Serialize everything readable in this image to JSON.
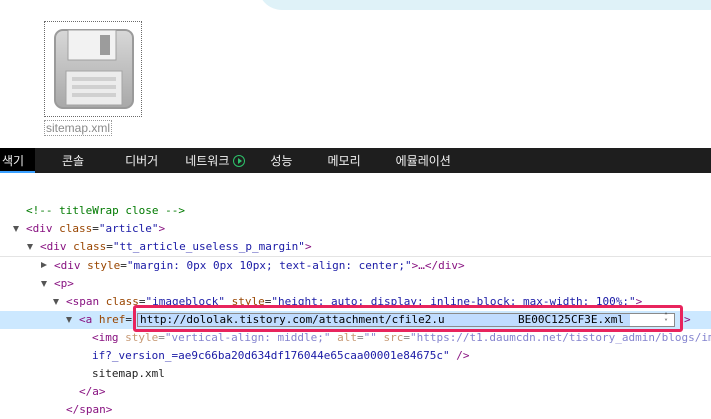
{
  "file_icon": {
    "label": "sitemap.xml",
    "icon": "floppy-disk-icon"
  },
  "tabs": [
    {
      "label": "색기",
      "active": true
    },
    {
      "label": "콘솔",
      "active": false
    },
    {
      "label": "디버거",
      "active": false
    },
    {
      "label": "네트워크",
      "active": false,
      "icon": "play-circle-icon"
    },
    {
      "label": "성능",
      "active": false
    },
    {
      "label": "메모리",
      "active": false
    },
    {
      "label": "에뮬레이션",
      "active": false
    }
  ],
  "dom_tree": {
    "line1": {
      "comment": "<!-- titleWrap close -->"
    },
    "line2": {
      "open": "<div ",
      "attr": "class",
      "eq": "=",
      "val": "\"article\"",
      "close": ">"
    },
    "line3": {
      "open": "<div ",
      "attr": "class",
      "eq": "=",
      "val": "\"tt_article_useless_p_margin\"",
      "close": ">"
    },
    "line4": {
      "open": "<div ",
      "attr": "style",
      "eq": "=",
      "val": "\"margin: 0px 0px 10px; text-align: center;\"",
      "close": ">…</div>"
    },
    "line5": {
      "tag": "<p>"
    },
    "line6": {
      "open": "<span ",
      "attr1": "class",
      "eq1": "=",
      "val1": "\"imageblock\"",
      "attr2": " style",
      "eq2": "=",
      "val2": "\"height: auto; display: inline-block; max-width: 100%;\"",
      "close": ">"
    },
    "line7": {
      "open": "<a ",
      "attr": "href",
      "eq": "=",
      "end": ">"
    },
    "line8": {
      "open": "<img ",
      "attr1": "style",
      "eq1": "=",
      "val1": "\"vertical-align: middle;\"",
      "attr2": " alt",
      "eq2": "=",
      "val2": "\"\"",
      "attr3": " src",
      "eq3": "=",
      "val3": "\"https://t1.daumcdn.net/tistory_admin/blogs/im"
    },
    "line9": {
      "val": "if?_version_=ae9c66ba20d634df176044e65caa00001e84675c\"",
      "close": " />"
    },
    "line10": {
      "text": "sitemap.xml"
    },
    "line11": {
      "tag": "</a>"
    },
    "line12": {
      "tag": "</span>"
    }
  },
  "url_editor": {
    "value_start": "http://dololak.tistory.com/attachment/cfile2.u",
    "value_end": "BE00C125CF3E.xml",
    "spinner_up": "˄",
    "spinner_down": "˅"
  }
}
